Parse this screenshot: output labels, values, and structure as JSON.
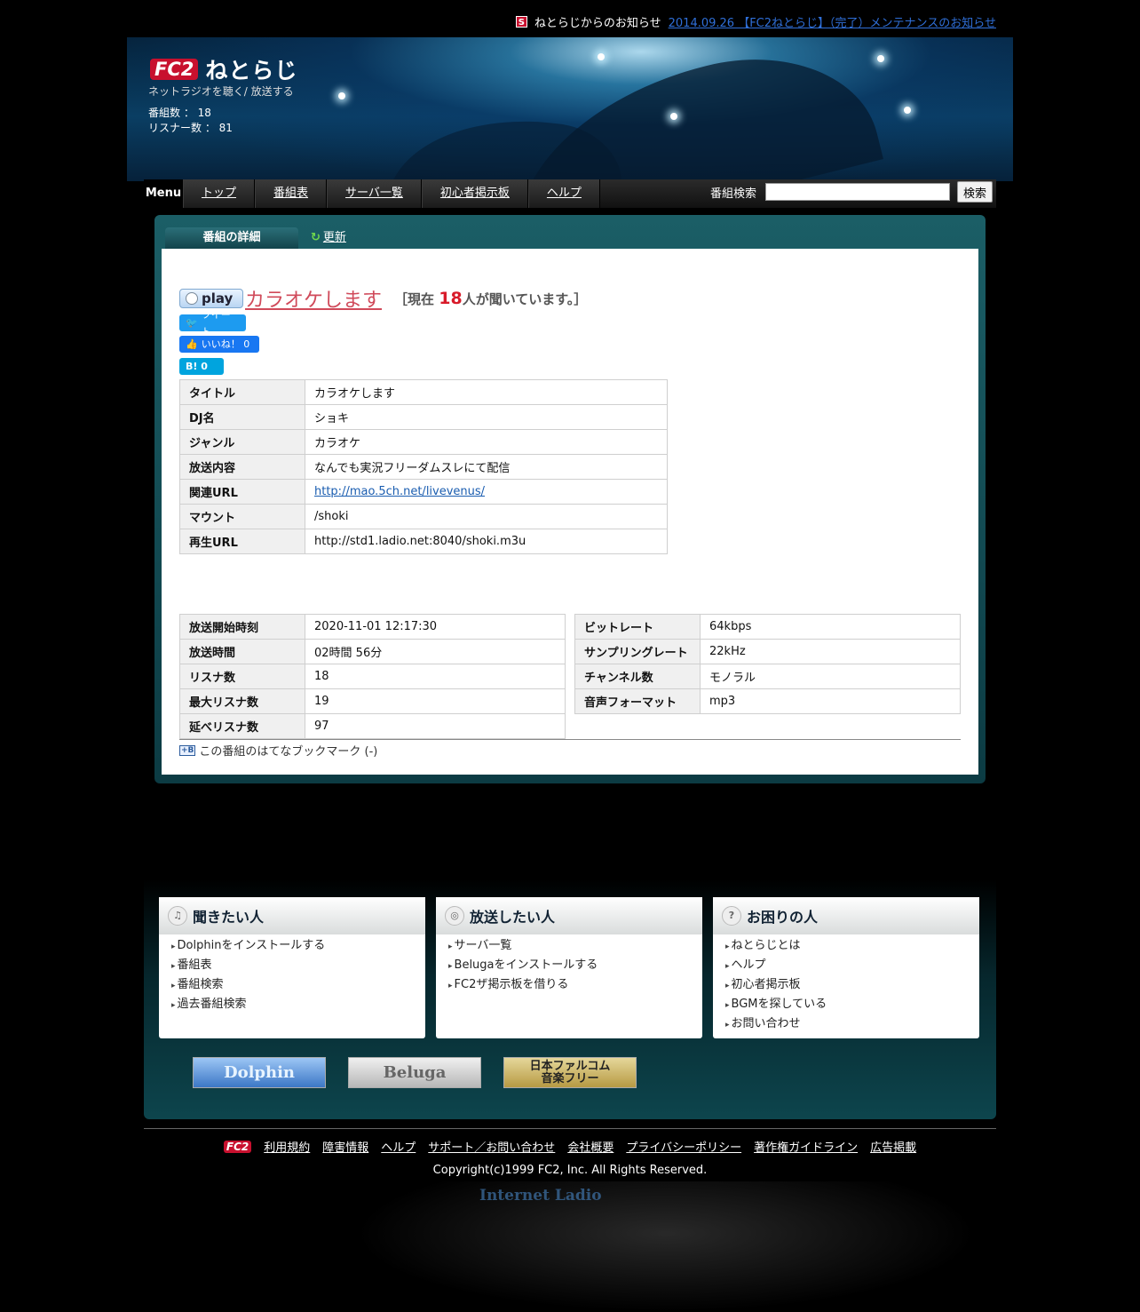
{
  "news": {
    "label": "ねとらじからのお知らせ",
    "link_text": "2014.09.26 【FC2ねとらじ】（完了）メンテナンスのお知らせ"
  },
  "header": {
    "logo_fc2": "FC2",
    "logo_name": "ねとらじ",
    "tagline": "ネットラジオを聴く/ 放送する",
    "programs_label": "番組数 ： 18",
    "listeners_label": "リスナー数 ： 81"
  },
  "menu": {
    "label": "Menu",
    "items": [
      "トップ",
      "番組表",
      "サーバ一覧",
      "初心者掲示板",
      "ヘルプ"
    ],
    "search_label": "番組検索",
    "search_button": "検索"
  },
  "tabs": {
    "detail": "番組の詳細",
    "refresh": "更新"
  },
  "program": {
    "play_label": "play",
    "title": "カラオケします",
    "listening_prefix": "［現在 ",
    "listening_count": "18",
    "listening_suffix": "人が聞いています。］"
  },
  "social": {
    "tweet": "ツイート",
    "like": "いいね！ 0",
    "hatena": "B! 0"
  },
  "details": [
    {
      "label": "タイトル",
      "value": "カラオケします"
    },
    {
      "label": "DJ名",
      "value": "ショキ"
    },
    {
      "label": "ジャンル",
      "value": "カラオケ"
    },
    {
      "label": "放送内容",
      "value": "なんでも実況フリーダムスレにて配信"
    },
    {
      "label": "関連URL",
      "value": "http://mao.5ch.net/livevenus/"
    },
    {
      "label": "マウント",
      "value": "/shoki"
    },
    {
      "label": "再生URL",
      "value": "http://std1.ladio.net:8040/shoki.m3u"
    }
  ],
  "stats": [
    {
      "label": "放送開始時刻",
      "value": "2020-11-01 12:17:30"
    },
    {
      "label": "放送時間",
      "value": "02時間 56分"
    },
    {
      "label": "リスナ数",
      "value": "18"
    },
    {
      "label": "最大リスナ数",
      "value": "19"
    },
    {
      "label": "延べリスナ数",
      "value": "97"
    }
  ],
  "audio": [
    {
      "label": "ビットレート",
      "value": "64kbps"
    },
    {
      "label": "サンプリングレート",
      "value": "22kHz"
    },
    {
      "label": "チャンネル数",
      "value": "モノラル"
    },
    {
      "label": "音声フォーマット",
      "value": "mp3"
    }
  ],
  "bookmark_text": "この番組のはてなブックマーク (-)",
  "boxes": {
    "listen": {
      "title": "聞きたい人",
      "items": [
        "Dolphinをインストールする",
        "番組表",
        "番組検索",
        "過去番組検索"
      ]
    },
    "broadcast": {
      "title": "放送したい人",
      "items": [
        "サーバ一覧",
        "Belugaをインストールする",
        "FC2ザ掲示板を借りる"
      ]
    },
    "help": {
      "title": "お困りの人",
      "items": [
        "ねとらじとは",
        "ヘルプ",
        "初心者掲示板",
        "BGMを探している",
        "お問い合わせ"
      ]
    }
  },
  "banners": {
    "dolphin": "Dolphin",
    "beluga": "Beluga",
    "falcom_line1": "日本ファルコム",
    "falcom_line2": "音楽フリー"
  },
  "footer": {
    "fc2": "FC2",
    "links": [
      "利用規約",
      "障害情報",
      "ヘルプ",
      "サポート／お問い合わせ",
      "会社概要",
      "プライバシーポリシー",
      "著作権ガイドライン",
      "広告掲載"
    ],
    "copyright": "Copyright(c)1999 FC2, Inc. All Rights Reserved.",
    "logo_text": "Internet Ladio"
  }
}
